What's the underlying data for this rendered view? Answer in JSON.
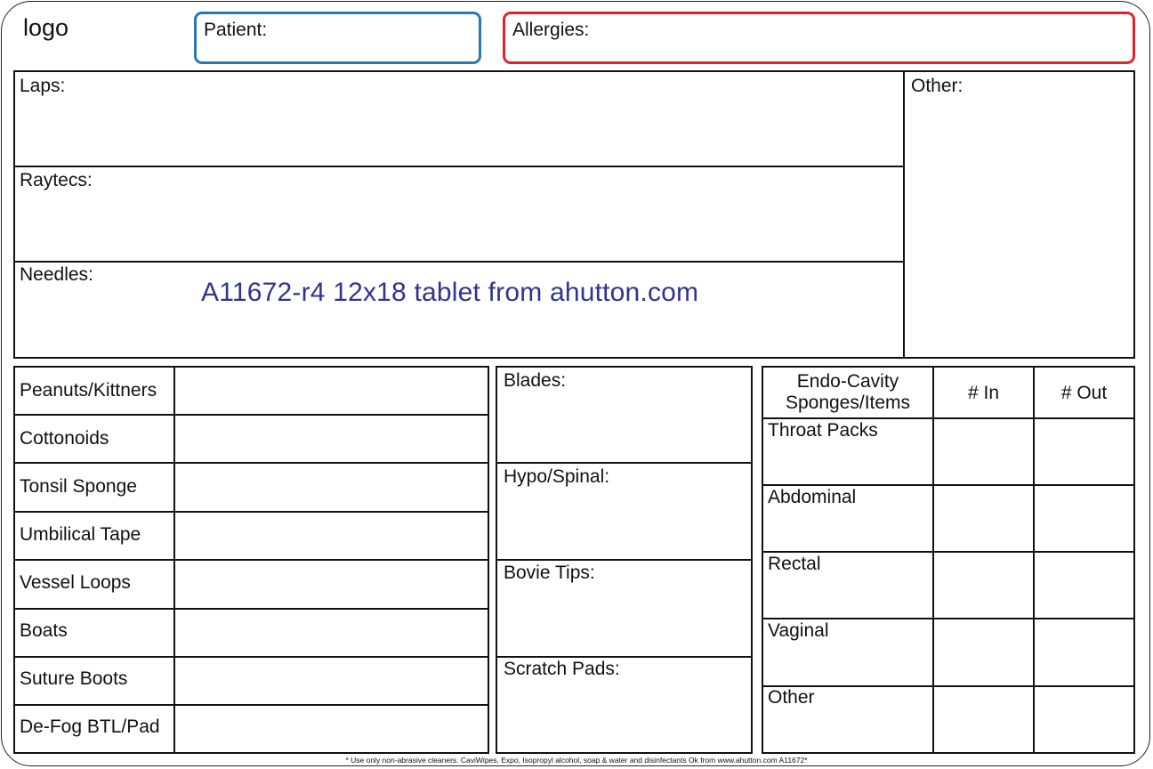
{
  "header": {
    "logo_text": "logo",
    "patient_label": "Patient:",
    "allergies_label": "Allergies:"
  },
  "top_section": {
    "rows": [
      {
        "label": "Laps:"
      },
      {
        "label": "Raytecs:"
      },
      {
        "label": "Needles:"
      }
    ],
    "other_label": "Other:",
    "watermark": "A11672-r4  12x18 tablet  from ahutton.com"
  },
  "left_table": {
    "rows": [
      {
        "label": "Peanuts/Kittners"
      },
      {
        "label": "Cottonoids"
      },
      {
        "label": "Tonsil Sponge"
      },
      {
        "label": "Umbilical Tape"
      },
      {
        "label": "Vessel Loops"
      },
      {
        "label": "Boats"
      },
      {
        "label": "Suture Boots"
      },
      {
        "label": "De-Fog BTL/Pad"
      }
    ]
  },
  "middle_table": {
    "rows": [
      {
        "label": "Blades:"
      },
      {
        "label": "Hypo/Spinal:"
      },
      {
        "label": "Bovie Tips:"
      },
      {
        "label": "Scratch Pads:"
      }
    ]
  },
  "right_table": {
    "header": {
      "col1_line1": "Endo-Cavity",
      "col1_line2": "Sponges/Items",
      "col2": "# In",
      "col3": "# Out"
    },
    "rows": [
      {
        "label": "Throat Packs"
      },
      {
        "label": "Abdominal"
      },
      {
        "label": "Rectal"
      },
      {
        "label": "Vaginal"
      },
      {
        "label": "Other"
      }
    ]
  },
  "footer": {
    "note": "* Use only non-abrasive cleaners. CaviWipes, Expo, Isopropyl alcohol, soap & water and disinfectants Ok from www.ahutton.com  A11672*"
  },
  "colors": {
    "patient_border": "#2878b5",
    "allergies_border": "#e0242f",
    "watermark": "#2f3590",
    "lines": "#111111"
  }
}
